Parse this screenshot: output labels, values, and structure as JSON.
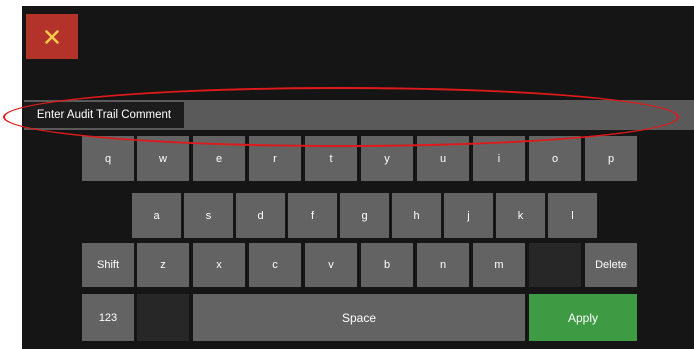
{
  "close_button": {
    "icon": "close-icon",
    "color": "#b3322a",
    "glyph_color": "#f2c94c"
  },
  "comment": {
    "label": "Enter Audit Trail Comment",
    "value": ""
  },
  "keyboard": {
    "row1": [
      "q",
      "w",
      "e",
      "r",
      "t",
      "y",
      "u",
      "i",
      "o",
      "p"
    ],
    "row2": [
      "a",
      "s",
      "d",
      "f",
      "g",
      "h",
      "j",
      "k",
      "l"
    ],
    "row3": [
      "z",
      "x",
      "c",
      "v",
      "b",
      "n",
      "m"
    ],
    "shift": "Shift",
    "delete": "Delete",
    "numbers": "123",
    "space": "Space",
    "apply": "Apply"
  },
  "colors": {
    "background": "#151515",
    "key": "#636363",
    "key_dark": "#272727",
    "apply": "#3e9a43",
    "annotation": "#e01a1a"
  }
}
